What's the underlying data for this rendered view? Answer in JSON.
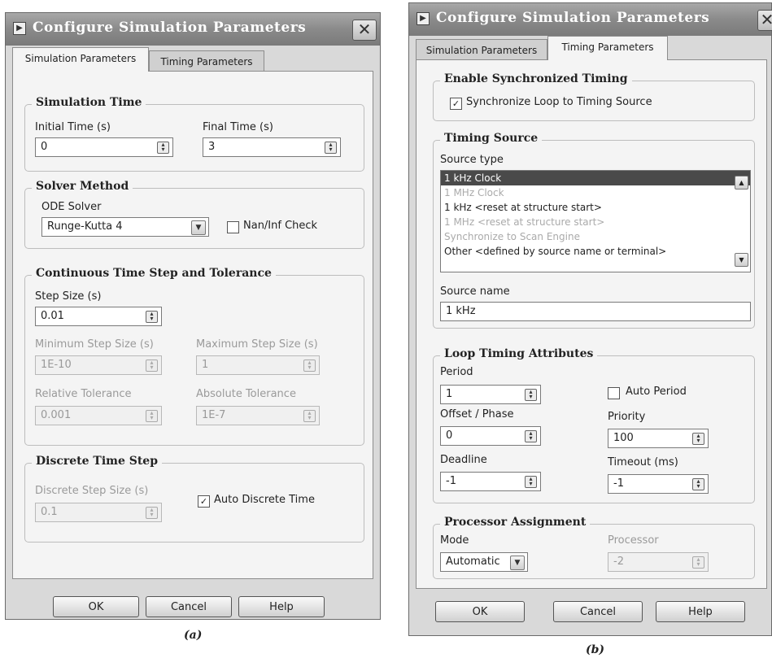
{
  "dialog_a": {
    "title": "Configure Simulation Parameters",
    "close": "✕",
    "tabs": [
      "Simulation Parameters",
      "Timing Parameters"
    ],
    "simulation_time": {
      "title": "Simulation Time",
      "initial_label": "Initial Time (s)",
      "initial_value": "0",
      "final_label": "Final Time (s)",
      "final_value": "3"
    },
    "solver": {
      "title": "Solver Method",
      "ode_label": "ODE Solver",
      "ode_value": "Runge-Kutta 4",
      "naninf_label": "Nan/Inf Check",
      "naninf_checked": false
    },
    "continuous": {
      "title": "Continuous Time Step and Tolerance",
      "step_label": "Step Size (s)",
      "step_value": "0.01",
      "min_label": "Minimum Step Size (s)",
      "min_value": "1E-10",
      "max_label": "Maximum Step Size (s)",
      "max_value": "1",
      "rel_label": "Relative Tolerance",
      "rel_value": "0.001",
      "abs_label": "Absolute Tolerance",
      "abs_value": "1E-7"
    },
    "discrete": {
      "title": "Discrete Time Step",
      "step_label": "Discrete Step Size (s)",
      "step_value": "0.1",
      "auto_label": "Auto Discrete Time",
      "auto_checked": true
    },
    "buttons": {
      "ok": "OK",
      "cancel": "Cancel",
      "help": "Help"
    },
    "caption": "(a)"
  },
  "dialog_b": {
    "title": "Configure Simulation Parameters",
    "close": "✕",
    "tabs": [
      "Simulation Parameters",
      "Timing Parameters"
    ],
    "sync": {
      "title": "Enable Synchronized Timing",
      "checkbox_label": "Synchronize Loop to Timing Source",
      "checked": true
    },
    "timing_source": {
      "title": "Timing Source",
      "type_label": "Source type",
      "items": [
        "1 kHz Clock",
        "1 MHz Clock",
        "1 kHz <reset at structure start>",
        "1 MHz <reset at structure start>",
        "Synchronize to Scan Engine",
        "Other <defined by source name or terminal>"
      ],
      "name_label": "Source name",
      "name_value": "1 kHz"
    },
    "loop_timing": {
      "title": "Loop Timing Attributes",
      "period_label": "Period",
      "period_value": "1",
      "auto_period_label": "Auto Period",
      "auto_period_checked": false,
      "offset_label": "Offset / Phase",
      "offset_value": "0",
      "priority_label": "Priority",
      "priority_value": "100",
      "deadline_label": "Deadline",
      "deadline_value": "-1",
      "timeout_label": "Timeout (ms)",
      "timeout_value": "-1"
    },
    "processor": {
      "title": "Processor Assignment",
      "mode_label": "Mode",
      "mode_value": "Automatic",
      "processor_label": "Processor",
      "processor_value": "-2"
    },
    "buttons": {
      "ok": "OK",
      "cancel": "Cancel",
      "help": "Help"
    },
    "caption": "(b)"
  }
}
